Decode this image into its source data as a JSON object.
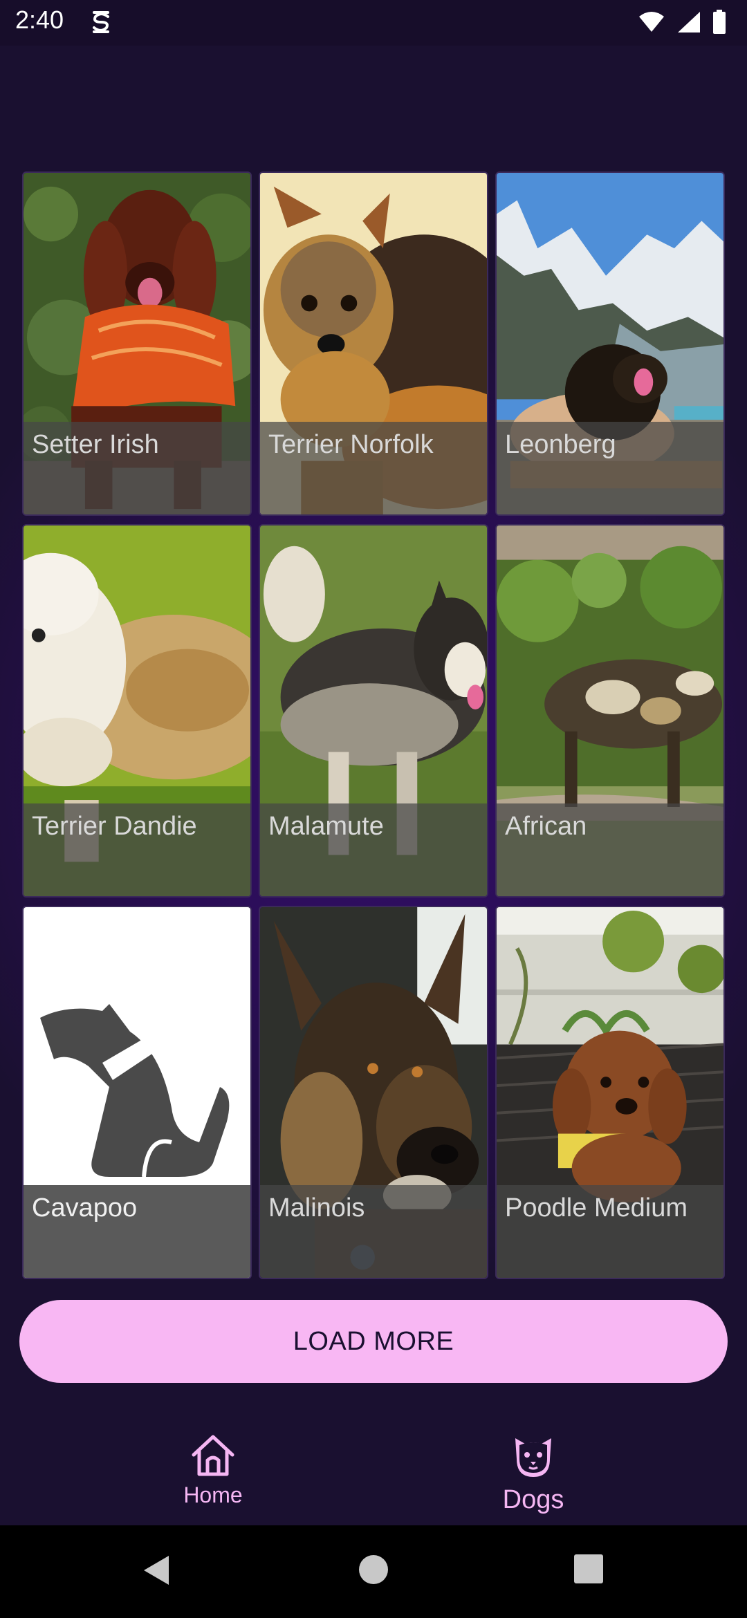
{
  "status_bar": {
    "time": "2:40"
  },
  "colors": {
    "background": "#1a1030",
    "accent": "#f8b7f3",
    "caption_overlay": "#464646"
  },
  "grid": {
    "items": [
      {
        "label": "Setter Irish",
        "image": "irish-setter-photo"
      },
      {
        "label": "Terrier Norfolk",
        "image": "norfolk-terrier-photo"
      },
      {
        "label": "Leonberg",
        "image": "leonberger-photo"
      },
      {
        "label": "Terrier Dandie",
        "image": "dandie-terrier-photo"
      },
      {
        "label": "Malamute",
        "image": "malamute-photo"
      },
      {
        "label": "African",
        "image": "african-wild-dog-photo"
      },
      {
        "label": "Cavapoo",
        "image": "placeholder-dog-icon"
      },
      {
        "label": "Malinois",
        "image": "malinois-photo"
      },
      {
        "label": "Poodle Medium",
        "image": "poodle-photo"
      }
    ]
  },
  "load_more": {
    "label": "LOAD MORE"
  },
  "bottom_nav": {
    "items": [
      {
        "label": "Home",
        "icon": "home-icon"
      },
      {
        "label": "Dogs",
        "icon": "dog-face-icon",
        "selected": true
      }
    ]
  },
  "system_nav": {
    "icons": [
      "back-icon",
      "home-circle-icon",
      "recents-icon"
    ]
  }
}
